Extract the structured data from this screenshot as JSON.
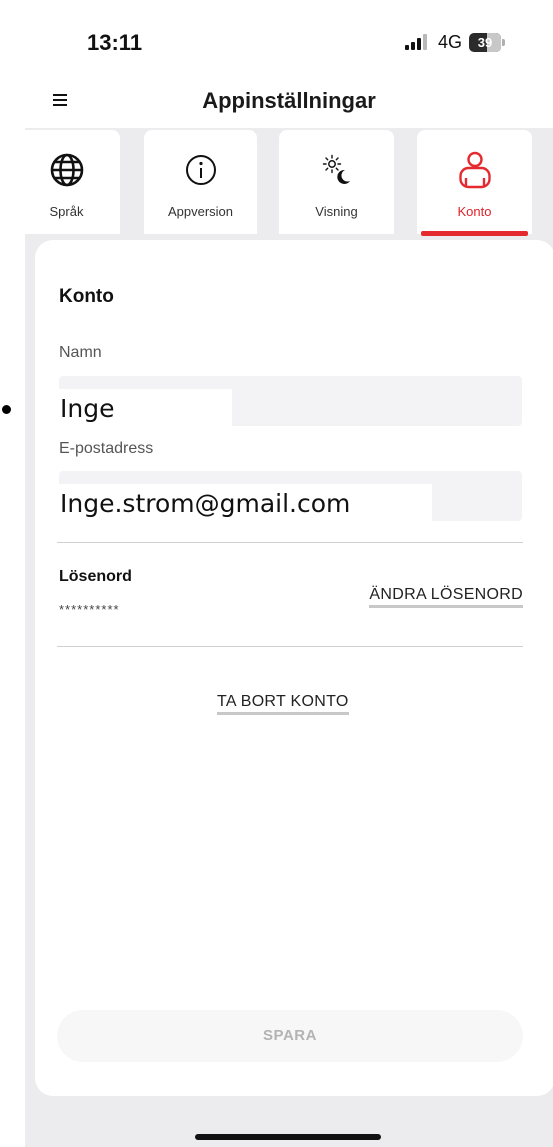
{
  "status_bar": {
    "time": "13:11",
    "network": "4G",
    "battery": "39"
  },
  "navbar": {
    "title": "Appinställningar"
  },
  "tabs": [
    {
      "label": "Språk",
      "icon": "globe-icon",
      "active": false
    },
    {
      "label": "Appversion",
      "icon": "info-icon",
      "active": false
    },
    {
      "label": "Visning",
      "icon": "sun-moon-icon",
      "active": false
    },
    {
      "label": "Konto",
      "icon": "user-icon",
      "active": true
    }
  ],
  "account": {
    "title": "Konto",
    "name_label": "Namn",
    "name_value": "Inge",
    "email_label": "E-postadress",
    "email_value": "Inge.strom@gmail.com",
    "password_label": "Lösenord",
    "password_mask": "**********",
    "change_password": "ÄNDRA LÖSENORD",
    "delete_account": "TA BORT KONTO",
    "save": "SPARA"
  },
  "colors": {
    "accent": "#e52a2f",
    "background": "#ececee",
    "card": "#ffffff"
  }
}
